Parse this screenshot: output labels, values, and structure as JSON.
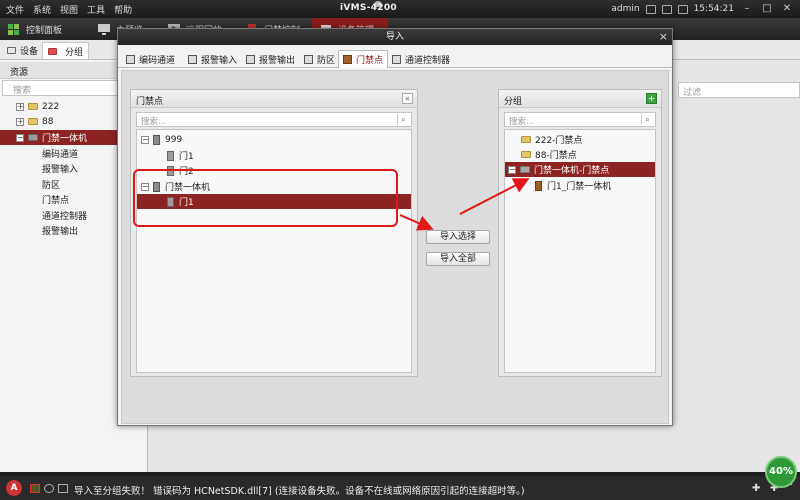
{
  "titlebar": {
    "menu": [
      "文件",
      "系统",
      "视图",
      "工具",
      "帮助"
    ],
    "app_title": "iVMS-4200",
    "user": "admin",
    "time": "15:54:21"
  },
  "navbar": {
    "tabs": [
      {
        "label": "控制面板"
      },
      {
        "label": "主预览"
      },
      {
        "label": "远程回放"
      },
      {
        "label": "门禁控制"
      },
      {
        "label": "设备管理",
        "active": true
      }
    ]
  },
  "subtabs": [
    {
      "label": "设备"
    },
    {
      "label": "分组",
      "active": true
    }
  ],
  "resource_panel": {
    "header": "资源",
    "search_placeholder": "搜索",
    "items": [
      {
        "label": "222",
        "type": "folder"
      },
      {
        "label": "88",
        "type": "folder"
      },
      {
        "label": "门禁一体机",
        "type": "folder",
        "selected": true
      },
      {
        "label": "编码通道"
      },
      {
        "label": "报警输入"
      },
      {
        "label": "防区"
      },
      {
        "label": "门禁点"
      },
      {
        "label": "通道控制器"
      },
      {
        "label": "报警输出"
      }
    ]
  },
  "filter_placeholder": "过滤",
  "dialog": {
    "title": "导入",
    "tabs": [
      {
        "label": "编码通道"
      },
      {
        "label": "报警输入"
      },
      {
        "label": "报警输出"
      },
      {
        "label": "防区"
      },
      {
        "label": "门禁点",
        "active": true
      },
      {
        "label": "通道控制器"
      }
    ],
    "left_pane": {
      "header": "门禁点",
      "search_placeholder": "搜索...",
      "tree": [
        {
          "label": "999",
          "level": 0,
          "type": "device",
          "toggle": "−"
        },
        {
          "label": "门1",
          "level": 1,
          "type": "door"
        },
        {
          "label": "门2",
          "level": 1,
          "type": "door"
        },
        {
          "label": "门禁一体机",
          "level": 0,
          "type": "device",
          "toggle": "−"
        },
        {
          "label": "门1",
          "level": 1,
          "type": "door",
          "selected": true
        }
      ]
    },
    "buttons": {
      "import_selected": "导入选择",
      "import_all": "导入全部"
    },
    "right_pane": {
      "header": "分组",
      "search_placeholder": "搜索...",
      "tree": [
        {
          "label": "222-门禁点",
          "level": 1,
          "type": "folder"
        },
        {
          "label": "88-门禁点",
          "level": 1,
          "type": "folder"
        },
        {
          "label": "门禁一体机-门禁点",
          "level": 0,
          "type": "folder",
          "toggle": "−",
          "selected": true
        },
        {
          "label": "门1_门禁一体机",
          "level": 2,
          "type": "door"
        }
      ]
    }
  },
  "statusbar": {
    "logo": "A",
    "message": "导入至分组失败！ 错误码为 HCNetSDK.dll[7] (连接设备失败。设备不在线或网络原因引起的连接超时等。)",
    "progress": "40%"
  },
  "colors": {
    "accent": "#8c2424",
    "annotation": "#e01818",
    "progress": "#2f9a35"
  }
}
